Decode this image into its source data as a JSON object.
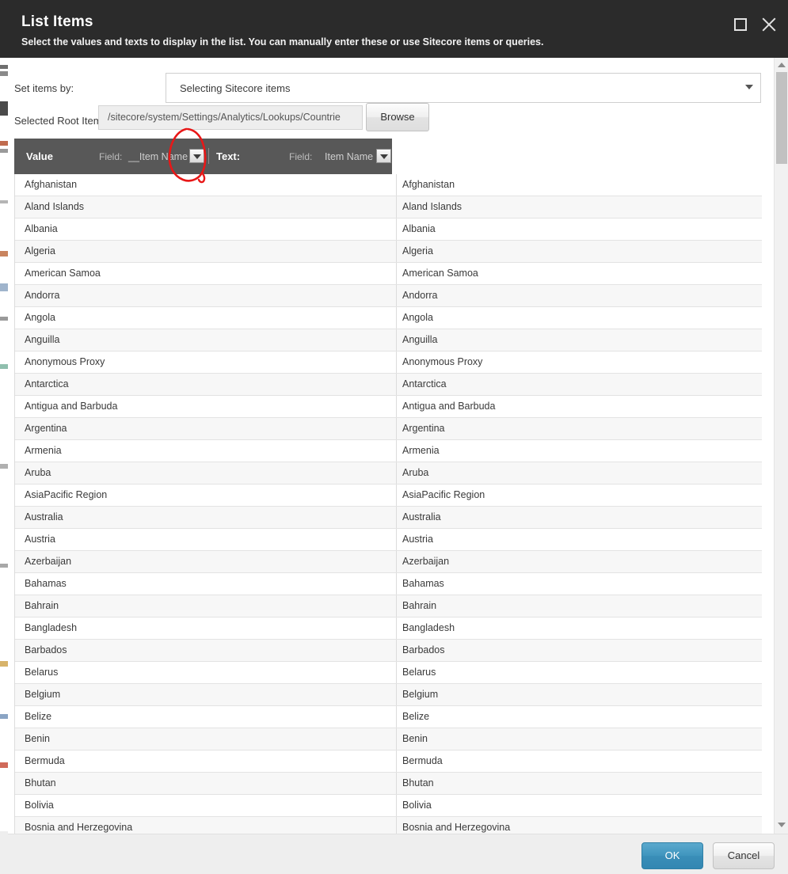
{
  "dialog": {
    "title": "List Items",
    "subtitle": "Select the values and texts to display in the list. You can manually enter these or use Sitecore items or queries.",
    "maximize_icon": "maximize-icon",
    "close_icon": "close-icon"
  },
  "form": {
    "set_items_by_label": "Set items by:",
    "set_items_by_value": "Selecting Sitecore items",
    "set_items_by_caret_icon": "chevron-down-icon",
    "selected_root_item_label": "Selected Root Item",
    "selected_root_item_value": "/sitecore/system/Settings/Analytics/Lookups/Countrie",
    "browse_label": "Browse"
  },
  "grid": {
    "value_header": "Value",
    "text_header": "Text:",
    "field_label_1": "Field:",
    "field_value_1": "__Item Name",
    "field_label_2": "Field:",
    "field_value_2": "Item Name",
    "dropdown_icon": "chevron-down-icon",
    "rows": [
      {
        "value": "Afghanistan",
        "text": "Afghanistan"
      },
      {
        "value": "Aland Islands",
        "text": "Aland Islands"
      },
      {
        "value": "Albania",
        "text": "Albania"
      },
      {
        "value": "Algeria",
        "text": "Algeria"
      },
      {
        "value": "American Samoa",
        "text": "American Samoa"
      },
      {
        "value": "Andorra",
        "text": "Andorra"
      },
      {
        "value": "Angola",
        "text": "Angola"
      },
      {
        "value": "Anguilla",
        "text": "Anguilla"
      },
      {
        "value": "Anonymous Proxy",
        "text": "Anonymous Proxy"
      },
      {
        "value": "Antarctica",
        "text": "Antarctica"
      },
      {
        "value": "Antigua and Barbuda",
        "text": "Antigua and Barbuda"
      },
      {
        "value": "Argentina",
        "text": "Argentina"
      },
      {
        "value": "Armenia",
        "text": "Armenia"
      },
      {
        "value": "Aruba",
        "text": "Aruba"
      },
      {
        "value": "AsiaPacific Region",
        "text": "AsiaPacific Region"
      },
      {
        "value": "Australia",
        "text": "Australia"
      },
      {
        "value": "Austria",
        "text": "Austria"
      },
      {
        "value": "Azerbaijan",
        "text": "Azerbaijan"
      },
      {
        "value": "Bahamas",
        "text": "Bahamas"
      },
      {
        "value": "Bahrain",
        "text": "Bahrain"
      },
      {
        "value": "Bangladesh",
        "text": "Bangladesh"
      },
      {
        "value": "Barbados",
        "text": "Barbados"
      },
      {
        "value": "Belarus",
        "text": "Belarus"
      },
      {
        "value": "Belgium",
        "text": "Belgium"
      },
      {
        "value": "Belize",
        "text": "Belize"
      },
      {
        "value": "Benin",
        "text": "Benin"
      },
      {
        "value": "Bermuda",
        "text": "Bermuda"
      },
      {
        "value": "Bhutan",
        "text": "Bhutan"
      },
      {
        "value": "Bolivia",
        "text": "Bolivia"
      },
      {
        "value": "Bosnia and Herzegovina",
        "text": "Bosnia and Herzegovina"
      }
    ]
  },
  "scrollbar": {
    "up_icon": "scroll-up-arrow-icon",
    "down_icon": "scroll-down-arrow-icon"
  },
  "footer": {
    "ok_label": "OK",
    "cancel_label": "Cancel"
  },
  "annotation": {
    "shape": "hand-drawn-oval",
    "color": "#e81717"
  },
  "colors": {
    "header_bg": "#2b2b2b",
    "grid_header_bg": "#585858",
    "accent_ok": "#3a8eb8",
    "row_alt": "#f7f7f7",
    "footer_bg": "#eeeeee",
    "annotation_red": "#e81717"
  }
}
